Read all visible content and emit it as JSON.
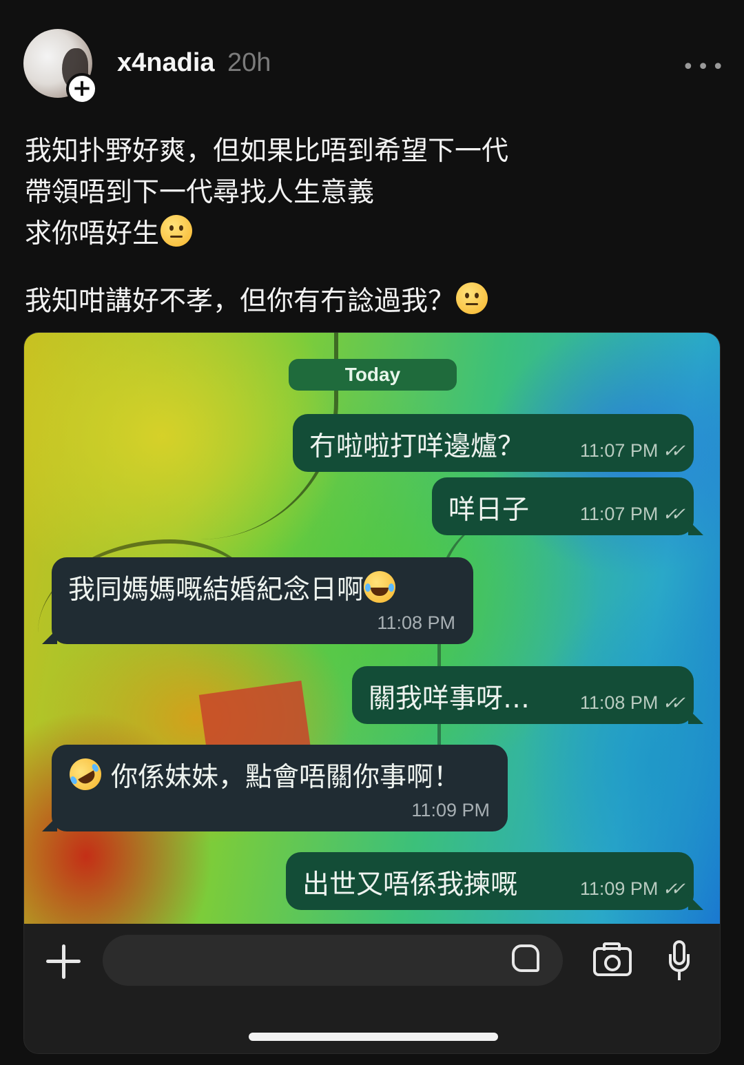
{
  "post": {
    "username": "x4nadia",
    "time_ago": "20h",
    "more_label": "•••",
    "lines": [
      "我知扑野好爽，但如果比唔到希望下一代",
      "帶領唔到下一代尋找人生意義",
      "求你唔好生",
      "我知咁講好不孝，但你有冇諗過我？"
    ]
  },
  "chat": {
    "date_chip": "Today",
    "messages": [
      {
        "dir": "out",
        "text": "冇啦啦打咩邊爐？",
        "time": "11:07 PM"
      },
      {
        "dir": "out",
        "text": "咩日子",
        "time": "11:07 PM"
      },
      {
        "dir": "in",
        "text": "我同媽媽嘅結婚紀念日啊",
        "time": "11:08 PM",
        "emoji": "laughing-tears-emoji"
      },
      {
        "dir": "out",
        "text": "關我咩事呀…",
        "time": "11:08 PM"
      },
      {
        "dir": "in",
        "text": "你係妹妹，點會唔關你事啊！",
        "time": "11:09 PM",
        "emoji": "rofl-emoji"
      },
      {
        "dir": "out",
        "text": "出世又唔係我揀嘅",
        "time": "11:09 PM"
      }
    ],
    "ticks": "✓✓"
  },
  "input_bar": {
    "icons": [
      "plus-icon",
      "sticker-icon",
      "camera-icon",
      "mic-icon"
    ]
  },
  "colors": {
    "background": "#101010",
    "outgoing_bubble": "#134d37",
    "incoming_bubble": "#202c33",
    "date_chip": "#1f6b3c"
  }
}
